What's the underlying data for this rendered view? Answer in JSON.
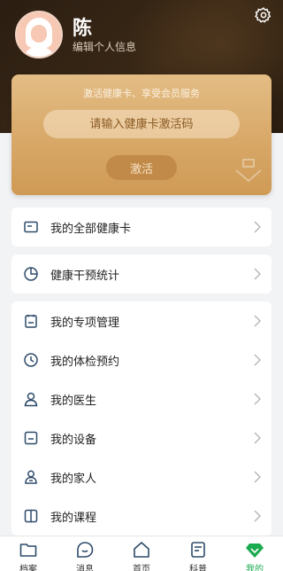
{
  "profile": {
    "name": "陈",
    "edit_label": "编辑个人信息"
  },
  "card": {
    "tagline": "激活健康卡、享受会员服务",
    "input_placeholder": "请输入健康卡激活码",
    "activate_label": "激活"
  },
  "menu": {
    "all_cards": "我的全部健康卡",
    "intervention_stats": "健康干预统计",
    "special_mgmt": "我的专项管理",
    "checkup": "我的体检预约",
    "doctor": "我的医生",
    "device": "我的设备",
    "family": "我的家人",
    "courses": "我的课程"
  },
  "tabs": {
    "records": "档案",
    "messages": "消息",
    "home": "首页",
    "science": "科普",
    "mine": "我的"
  },
  "colors": {
    "accent": "#1aaa4f",
    "icon": "#2d4b6a",
    "card_gold": "#d8a868"
  }
}
